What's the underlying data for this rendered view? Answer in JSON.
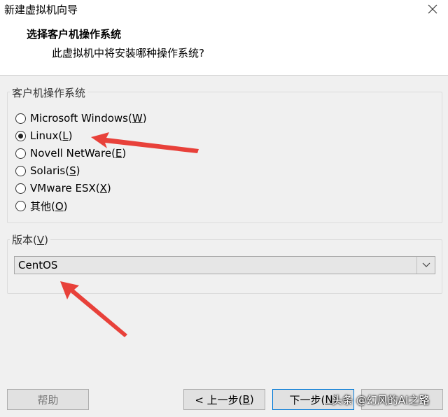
{
  "window": {
    "title": "新建虚拟机向导"
  },
  "header": {
    "title": "选择客户机操作系统",
    "subtitle": "此虚拟机中将安装哪种操作系统?"
  },
  "os_group": {
    "label": "客户机操作系统",
    "options": [
      {
        "text": "Microsoft Windows(",
        "key": "W",
        "close": ")",
        "selected": false
      },
      {
        "text": "Linux(",
        "key": "L",
        "close": ")",
        "selected": true
      },
      {
        "text": "Novell NetWare(",
        "key": "E",
        "close": ")",
        "selected": false
      },
      {
        "text": "Solaris(",
        "key": "S",
        "close": ")",
        "selected": false
      },
      {
        "text": "VMware ESX(",
        "key": "X",
        "close": ")",
        "selected": false
      },
      {
        "text": "其他(",
        "key": "O",
        "close": ")",
        "selected": false
      }
    ]
  },
  "version_group": {
    "label_text": "版本(",
    "label_key": "V",
    "label_close": ")",
    "selected": "CentOS"
  },
  "buttons": {
    "help": "帮助",
    "back_text": "< 上一步(",
    "back_key": "B",
    "back_close": ")",
    "next_text": "下一步(",
    "next_key": "N",
    "next_close": ")"
  },
  "watermark": "头条 @幻风的AI之路",
  "colors": {
    "annotation_arrow": "#e8413a",
    "focus_border": "#0078d7"
  }
}
